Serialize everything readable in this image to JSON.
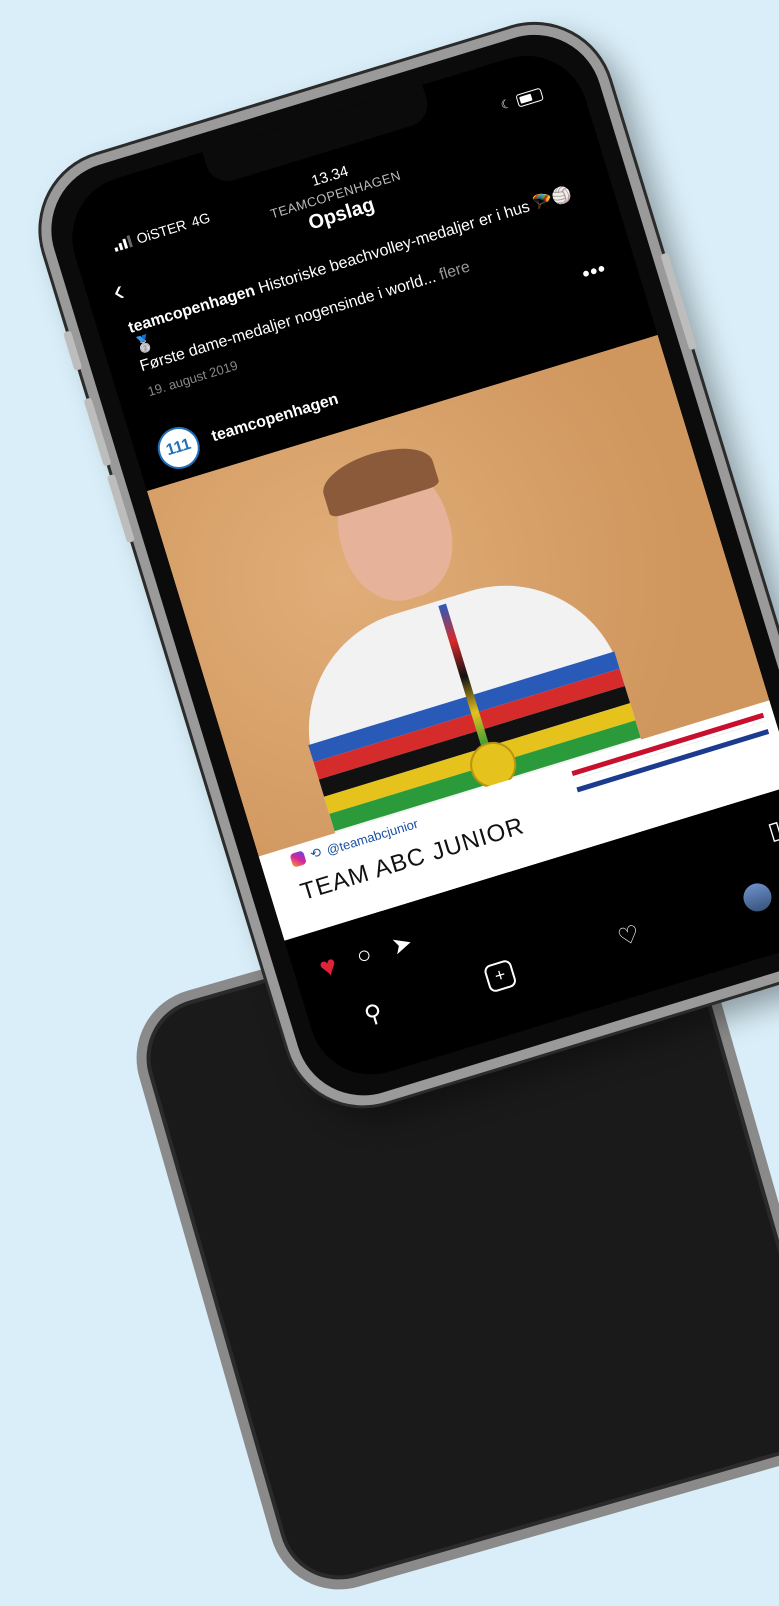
{
  "status": {
    "time": "13.34",
    "carrier": "OiSTER",
    "network": "4G"
  },
  "header": {
    "account": "TEAMCOPENHAGEN",
    "title": "Opslag"
  },
  "caption": {
    "user": "teamcopenhagen",
    "text": "Historiske beachvolley-medaljer er i hus",
    "emoji": "🪂🏐🥈",
    "line2": "Første dame-medaljer nogensinde i world...",
    "more": "flere",
    "date": "19. august 2019"
  },
  "post": {
    "user": "teamcopenhagen",
    "avatar_text": "111"
  },
  "overlay": {
    "handle": "@teamabcjunior",
    "team": "TEAM ABC JUNIOR"
  },
  "icons": {
    "heart": "♥",
    "comment": "○",
    "share": "➤",
    "bookmark": "▯",
    "search": "⚲",
    "add": "+",
    "like_outline": "♡",
    "back": "‹",
    "more": "•••"
  },
  "colors": {
    "background": "#d9eef8",
    "like": "#e0223b",
    "photo_wall": "#d9a46f"
  }
}
